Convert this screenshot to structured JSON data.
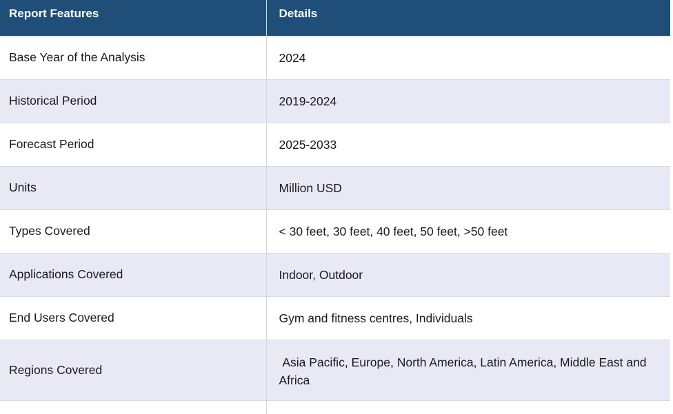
{
  "table": {
    "headers": [
      "Report Features",
      "Details"
    ],
    "rows": [
      {
        "feature": "Base Year of the Analysis",
        "details": "2024"
      },
      {
        "feature": "Historical Period",
        "details": "2019-2024"
      },
      {
        "feature": "Forecast Period",
        "details": "2025-2033"
      },
      {
        "feature": "Units",
        "details": "Million USD"
      },
      {
        "feature": "Types Covered",
        "details": "< 30 feet, 30 feet, 40 feet, 50 feet, >50 feet"
      },
      {
        "feature": "Applications Covered",
        "details": "Indoor, Outdoor"
      },
      {
        "feature": "End Users Covered",
        "details": "Gym and fitness centres, Individuals"
      },
      {
        "feature": "Regions Covered",
        "details": " Asia Pacific, Europe, North America, Latin America, Middle East and Africa"
      }
    ]
  },
  "colors": {
    "header_bg": "#1f4e79",
    "header_text": "#ffffff",
    "alt_row_bg": "#e8e9f5",
    "row_bg": "#ffffff"
  }
}
